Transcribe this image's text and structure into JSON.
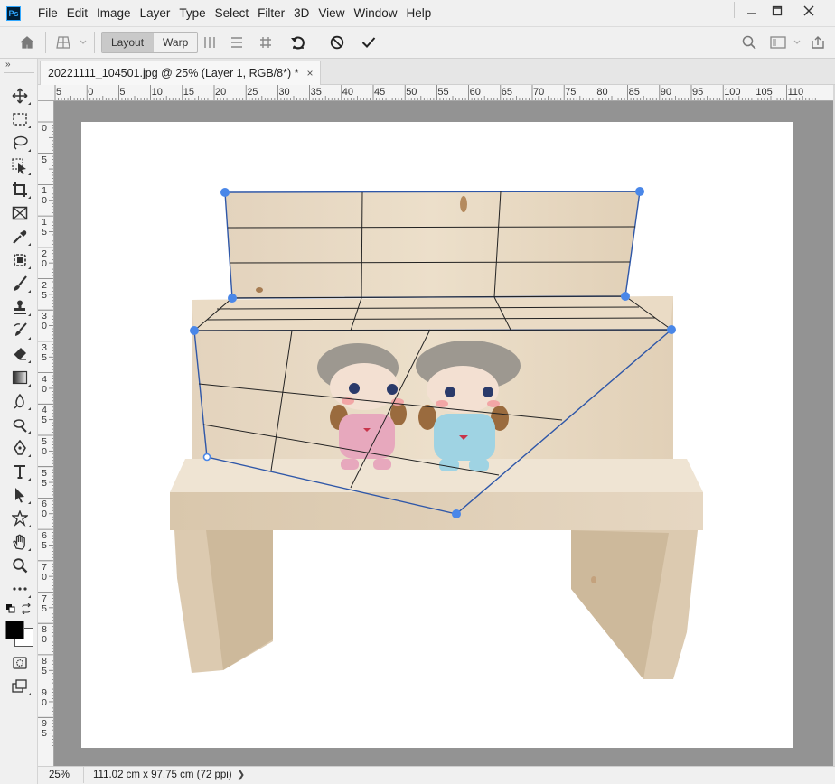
{
  "app": {
    "logo_text": "Ps"
  },
  "menu": [
    "File",
    "Edit",
    "Image",
    "Layer",
    "Type",
    "Select",
    "Filter",
    "3D",
    "View",
    "Window",
    "Help"
  ],
  "window_controls": {
    "minimize": "minimize-icon",
    "maximize": "maximize-icon",
    "close": "close-icon"
  },
  "options_bar": {
    "home_icon": "home-icon",
    "tool_icon": "perspective-warp-icon",
    "modes": [
      "Layout",
      "Warp"
    ],
    "active_mode": "Layout",
    "actions": [
      "auto-straighten-vertical-icon",
      "auto-level-horizontal-icon",
      "auto-level-and-straighten-icon",
      "undo-icon",
      "cancel-icon",
      "commit-icon"
    ],
    "right_icons": [
      "search-icon",
      "workspace-icon",
      "share-icon"
    ]
  },
  "document": {
    "tab_title": "20221111_104501.jpg @ 25% (Layer 1, RGB/8*) *",
    "close_glyph": "×",
    "zoom": "25%",
    "size_info": "111.02 cm x 97.75 cm (72 ppi)",
    "status_arrow": "❯"
  },
  "rulers": {
    "horizontal": [
      "5",
      "0",
      "5",
      "10",
      "15",
      "20",
      "25",
      "30",
      "35",
      "40",
      "45",
      "50",
      "55",
      "60",
      "65",
      "70",
      "75",
      "80",
      "85",
      "90",
      "95",
      "100",
      "105",
      "110"
    ],
    "vertical": [
      "0",
      "5",
      "10",
      "15",
      "20",
      "25",
      "30",
      "35",
      "40",
      "45",
      "50",
      "55",
      "60",
      "65",
      "70",
      "75",
      "80",
      "85",
      "90",
      "95"
    ]
  },
  "tools": [
    "move-tool-icon",
    "marquee-tool-icon",
    "lasso-tool-icon",
    "object-select-tool-icon",
    "crop-tool-icon",
    "frame-tool-icon",
    "eyedropper-tool-icon",
    "spot-healing-tool-icon",
    "brush-tool-icon",
    "clone-stamp-tool-icon",
    "history-brush-tool-icon",
    "eraser-tool-icon",
    "gradient-tool-icon",
    "blur-tool-icon",
    "dodge-tool-icon",
    "pen-tool-icon",
    "type-tool-icon",
    "path-selection-tool-icon",
    "custom-shape-tool-icon",
    "hand-tool-icon",
    "zoom-tool-icon",
    "more-tools-icon"
  ],
  "colors": {
    "foreground": "#000000",
    "background": "#ffffff",
    "warp_handle": "#4a87e8",
    "pasteboard": "#939393"
  }
}
